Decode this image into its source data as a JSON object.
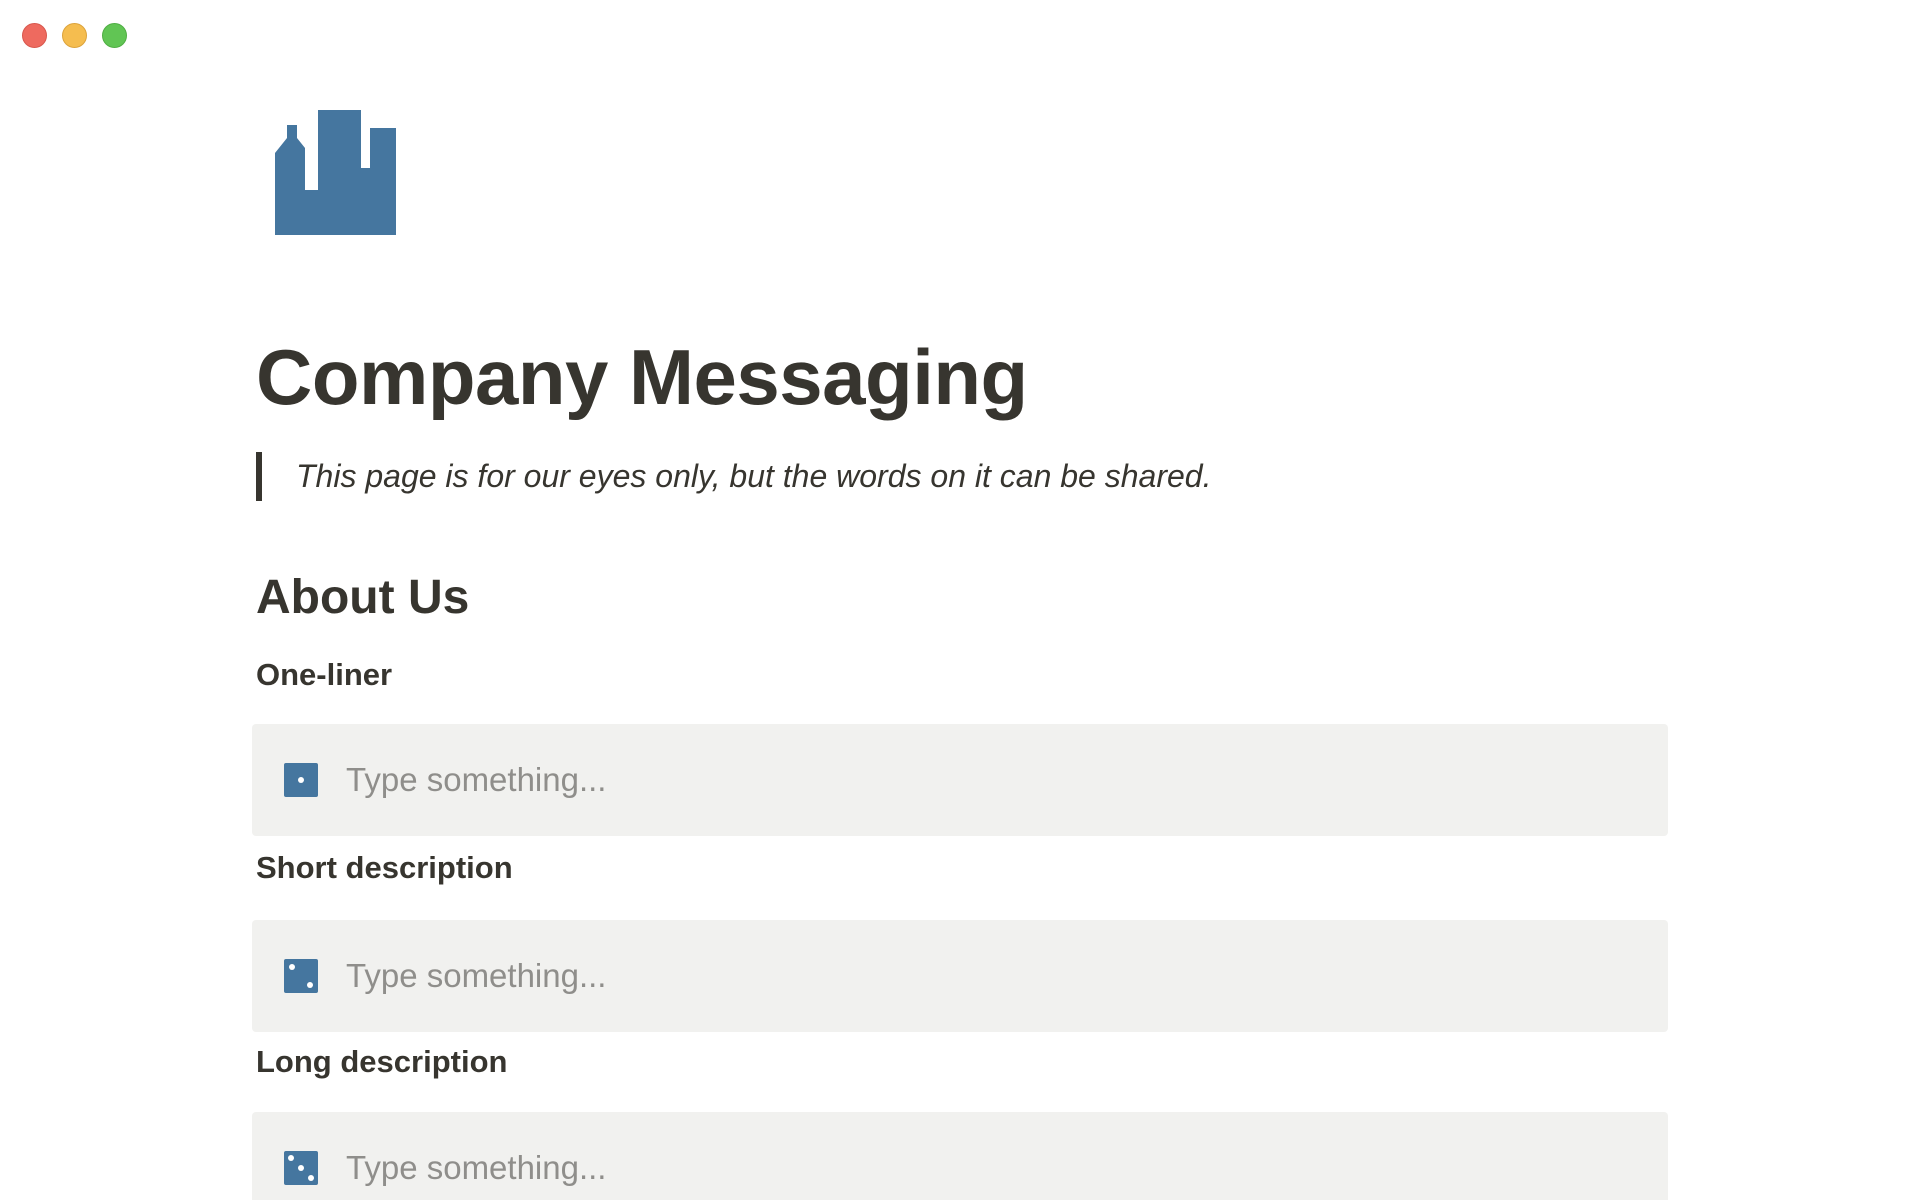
{
  "window": {
    "controls": {
      "close": "close-button",
      "minimize": "minimize-button",
      "maximize": "maximize-button"
    }
  },
  "page": {
    "icon": "city-buildings-icon",
    "icon_color": "#45769f",
    "title": "Company Messaging",
    "quote": "This page is for our eyes only, but the words on it can be shared."
  },
  "sections": {
    "about": {
      "heading": "About Us",
      "fields": [
        {
          "label": "One-liner",
          "placeholder": "Type something...",
          "icon": "dice-one-icon"
        },
        {
          "label": "Short description",
          "placeholder": "Type something...",
          "icon": "dice-two-icon"
        },
        {
          "label": "Long description",
          "placeholder": "Type something...",
          "icon": "dice-three-icon"
        }
      ]
    }
  },
  "colors": {
    "text": "#37352f",
    "callout_bg": "#f1f1ef",
    "placeholder": "#8f8e8b",
    "accent": "#45769f"
  }
}
